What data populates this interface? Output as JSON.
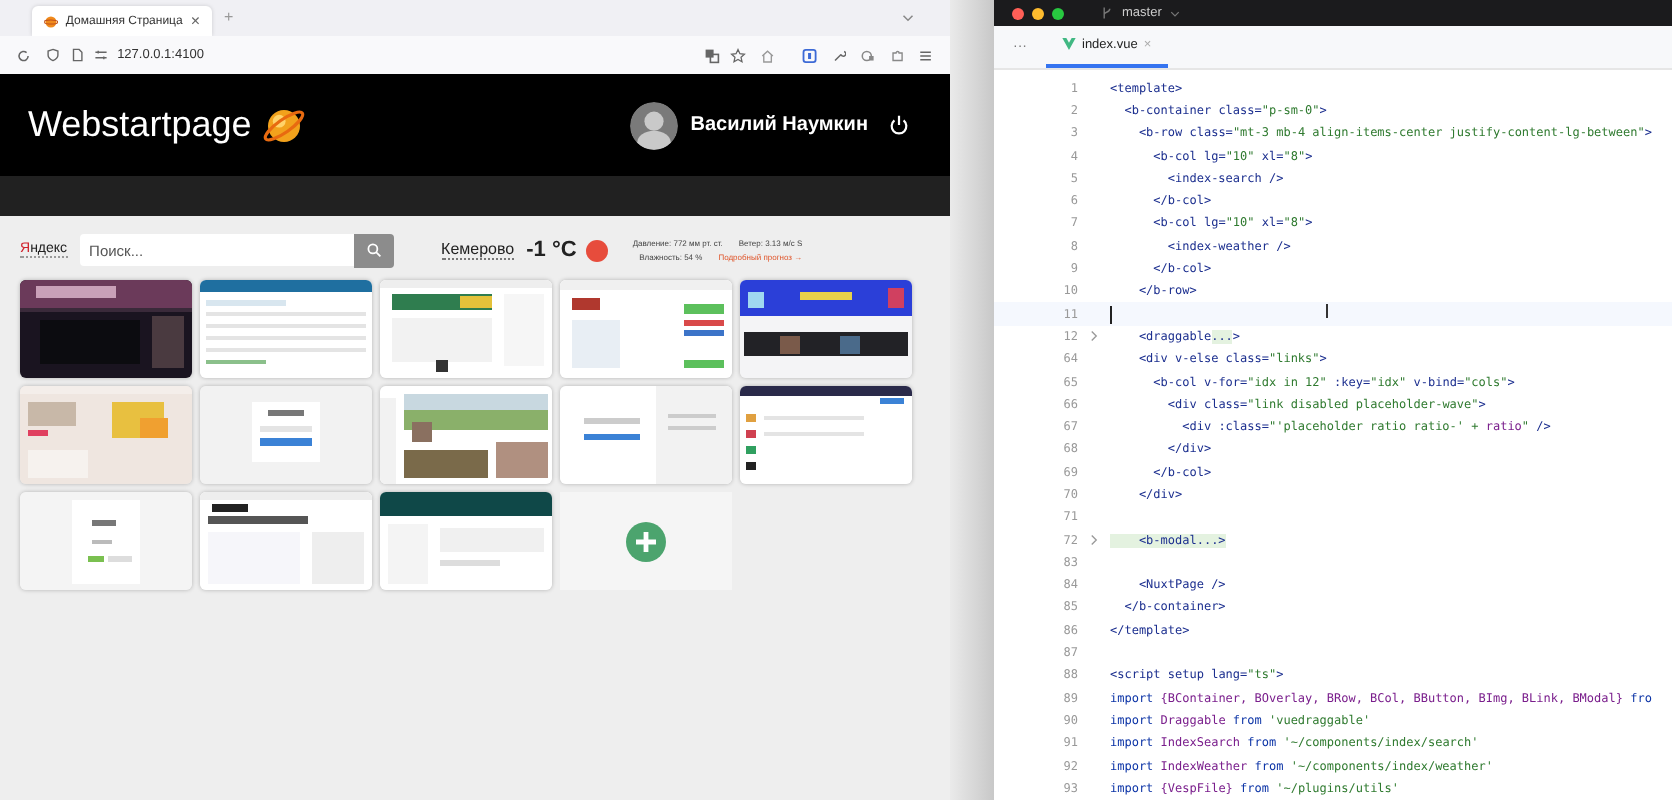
{
  "browser": {
    "tab": {
      "title": "Домашняя Страница",
      "close": "×",
      "selected": true
    },
    "new_tab": "+",
    "url": "127.0.0.1:4100"
  },
  "site": {
    "logo": "Webstartpage",
    "user": {
      "name": "Василий Наумкин"
    },
    "search": {
      "engine": "Яндекс",
      "placeholder": "Поиск..."
    },
    "weather": {
      "city": "Кемерово",
      "temperature": "-1 °C",
      "pressure": "Давление: 772 мм рт. ст.",
      "wind": "Ветер: 3.13 м/с S",
      "humidity": "Влажность: 54 %",
      "forecast_link": "Подробный прогноз →"
    },
    "tiles": [
      {
        "kind": "picture"
      },
      {
        "kind": "picture"
      },
      {
        "kind": "picture"
      },
      {
        "kind": "picture"
      },
      {
        "kind": "picture"
      },
      {
        "kind": "picture"
      },
      {
        "kind": "picture"
      },
      {
        "kind": "picture"
      },
      {
        "kind": "picture"
      },
      {
        "kind": "picture"
      },
      {
        "kind": "picture"
      },
      {
        "kind": "picture"
      },
      {
        "kind": "picture"
      },
      {
        "kind": "add"
      }
    ]
  },
  "editor": {
    "branch": "master",
    "file_tab": {
      "title": "index.vue",
      "close": "×",
      "selected": true
    },
    "more": "···",
    "lines": [
      {
        "no": "1",
        "segments": [
          {
            "t": "<template>",
            "kind": "tag"
          }
        ]
      },
      {
        "no": "2",
        "segments": [
          {
            "t": "  <b-container ",
            "kind": "tag"
          },
          {
            "t": "class=",
            "kind": "attr"
          },
          {
            "t": "\"p-sm-0\"",
            "kind": "str"
          },
          {
            "t": ">",
            "kind": "tag"
          }
        ]
      },
      {
        "no": "3",
        "segments": [
          {
            "t": "    <b-row ",
            "kind": "tag"
          },
          {
            "t": "class=",
            "kind": "attr"
          },
          {
            "t": "\"mt-3 mb-4 align-items-center justify-content-lg-between\"",
            "kind": "str"
          },
          {
            "t": ">",
            "kind": "tag"
          }
        ]
      },
      {
        "no": "4",
        "segments": [
          {
            "t": "      <b-col ",
            "kind": "tag"
          },
          {
            "t": "lg=",
            "kind": "attr"
          },
          {
            "t": "\"10\" ",
            "kind": "str"
          },
          {
            "t": "xl=",
            "kind": "attr"
          },
          {
            "t": "\"8\"",
            "kind": "str"
          },
          {
            "t": ">",
            "kind": "tag"
          }
        ]
      },
      {
        "no": "5",
        "segments": [
          {
            "t": "        <index-search />",
            "kind": "tag"
          }
        ]
      },
      {
        "no": "6",
        "segments": [
          {
            "t": "      </b-col>",
            "kind": "tag"
          }
        ]
      },
      {
        "no": "7",
        "segments": [
          {
            "t": "      <b-col ",
            "kind": "tag"
          },
          {
            "t": "lg=",
            "kind": "attr"
          },
          {
            "t": "\"10\" ",
            "kind": "str"
          },
          {
            "t": "xl=",
            "kind": "attr"
          },
          {
            "t": "\"8\"",
            "kind": "str"
          },
          {
            "t": ">",
            "kind": "tag"
          }
        ]
      },
      {
        "no": "8",
        "segments": [
          {
            "t": "        <index-weather />",
            "kind": "tag"
          }
        ]
      },
      {
        "no": "9",
        "segments": [
          {
            "t": "      </b-col>",
            "kind": "tag"
          }
        ]
      },
      {
        "no": "10",
        "segments": [
          {
            "t": "    </b-row>",
            "kind": "tag"
          }
        ]
      },
      {
        "no": "11",
        "current": true
      },
      {
        "no": "12",
        "folded": true,
        "segments": [
          {
            "t": "    <draggable",
            "kind": "tag"
          },
          {
            "t": "...",
            "kind": "fold"
          },
          {
            "t": ">",
            "kind": "tag"
          }
        ]
      },
      {
        "no": "64",
        "segments": [
          {
            "t": "    <div ",
            "kind": "tag"
          },
          {
            "t": "v-else class=",
            "kind": "attr"
          },
          {
            "t": "\"links\"",
            "kind": "str"
          },
          {
            "t": ">",
            "kind": "tag"
          }
        ]
      },
      {
        "no": "65",
        "segments": [
          {
            "t": "      <b-col ",
            "kind": "tag"
          },
          {
            "t": "v-for=",
            "kind": "attr"
          },
          {
            "t": "\"idx in 12\" ",
            "kind": "str"
          },
          {
            "t": ":key=",
            "kind": "attr"
          },
          {
            "t": "\"idx\" ",
            "kind": "str"
          },
          {
            "t": "v-bind=",
            "kind": "attr"
          },
          {
            "t": "\"cols\"",
            "kind": "str"
          },
          {
            "t": ">",
            "kind": "tag"
          }
        ]
      },
      {
        "no": "66",
        "segments": [
          {
            "t": "        <div ",
            "kind": "tag"
          },
          {
            "t": "class=",
            "kind": "attr"
          },
          {
            "t": "\"link disabled placeholder-wave\"",
            "kind": "str"
          },
          {
            "t": ">",
            "kind": "tag"
          }
        ]
      },
      {
        "no": "67",
        "segments": [
          {
            "t": "          <div ",
            "kind": "tag"
          },
          {
            "t": ":class=",
            "kind": "attr"
          },
          {
            "t": "\"'placeholder ratio ratio-' + ",
            "kind": "str"
          },
          {
            "t": "ratio",
            "kind": "ident"
          },
          {
            "t": "\"",
            "kind": "str"
          },
          {
            "t": " />",
            "kind": "tag"
          }
        ]
      },
      {
        "no": "68",
        "segments": [
          {
            "t": "        </div>",
            "kind": "tag"
          }
        ]
      },
      {
        "no": "69",
        "segments": [
          {
            "t": "      </b-col>",
            "kind": "tag"
          }
        ]
      },
      {
        "no": "70",
        "segments": [
          {
            "t": "    </div>",
            "kind": "tag"
          }
        ]
      },
      {
        "no": "71"
      },
      {
        "no": "72",
        "folded": true,
        "segments": [
          {
            "t": "    <b-modal...>",
            "kind": "fold"
          }
        ]
      },
      {
        "no": "83"
      },
      {
        "no": "84",
        "segments": [
          {
            "t": "    <NuxtPage />",
            "kind": "tag"
          }
        ]
      },
      {
        "no": "85",
        "segments": [
          {
            "t": "  </b-container>",
            "kind": "tag"
          }
        ]
      },
      {
        "no": "86",
        "segments": [
          {
            "t": "</template>",
            "kind": "tag"
          }
        ]
      },
      {
        "no": "87"
      },
      {
        "no": "88",
        "segments": [
          {
            "t": "<script ",
            "kind": "tag"
          },
          {
            "t": "setup lang=",
            "kind": "attr"
          },
          {
            "t": "\"ts\"",
            "kind": "str"
          },
          {
            "t": ">",
            "kind": "tag"
          }
        ]
      },
      {
        "no": "89",
        "segments": [
          {
            "t": "import ",
            "kind": "kw"
          },
          {
            "t": "{BContainer, BOverlay, BRow, BCol, BButton, BImg, BLink, BModal} ",
            "kind": "ident"
          },
          {
            "t": "fro",
            "kind": "kw"
          }
        ]
      },
      {
        "no": "90",
        "segments": [
          {
            "t": "import ",
            "kind": "kw"
          },
          {
            "t": "Draggable ",
            "kind": "ident"
          },
          {
            "t": "from ",
            "kind": "kw"
          },
          {
            "t": "'vuedraggable'",
            "kind": "str"
          }
        ]
      },
      {
        "no": "91",
        "segments": [
          {
            "t": "import ",
            "kind": "kw"
          },
          {
            "t": "IndexSearch ",
            "kind": "ident"
          },
          {
            "t": "from ",
            "kind": "kw"
          },
          {
            "t": "'~/components/index/search'",
            "kind": "str"
          }
        ]
      },
      {
        "no": "92",
        "segments": [
          {
            "t": "import ",
            "kind": "kw"
          },
          {
            "t": "IndexWeather ",
            "kind": "ident"
          },
          {
            "t": "from ",
            "kind": "kw"
          },
          {
            "t": "'~/components/index/weather'",
            "kind": "str"
          }
        ]
      },
      {
        "no": "93",
        "segments": [
          {
            "t": "import ",
            "kind": "kw"
          },
          {
            "t": "{VespFile} ",
            "kind": "ident"
          },
          {
            "t": "from ",
            "kind": "kw"
          },
          {
            "t": "'~/plugins/utils'",
            "kind": "str"
          }
        ]
      }
    ]
  }
}
